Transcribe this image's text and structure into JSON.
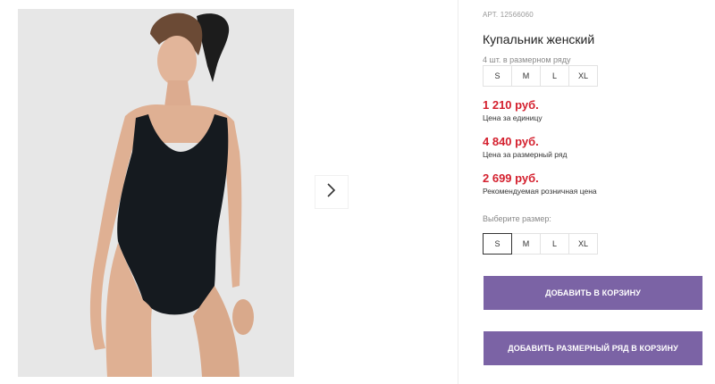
{
  "product": {
    "sku": "АРТ. 12566060",
    "title": "Купальник женский",
    "pack_label": "4 шт. в размерном ряду",
    "pack_sizes": [
      "S",
      "M",
      "L",
      "XL"
    ],
    "prices": [
      {
        "value": "1 210 руб.",
        "note": "Цена за единицу"
      },
      {
        "value": "4 840 руб.",
        "note": "Цена за размерный ряд"
      },
      {
        "value": "2 699 руб.",
        "note": "Рекомендуемая розничная цена"
      }
    ],
    "choose_size_label": "Выберите размер:",
    "size_options": [
      "S",
      "M",
      "L",
      "XL"
    ],
    "selected_size": "S"
  },
  "actions": {
    "add_to_cart": "Добавить в корзину",
    "add_pack_to_cart": "Добавить размерный ряд в корзину"
  },
  "icons": {
    "next": "chevron-right-icon"
  },
  "colors": {
    "price": "#d4202e",
    "button": "#7b63a5"
  }
}
